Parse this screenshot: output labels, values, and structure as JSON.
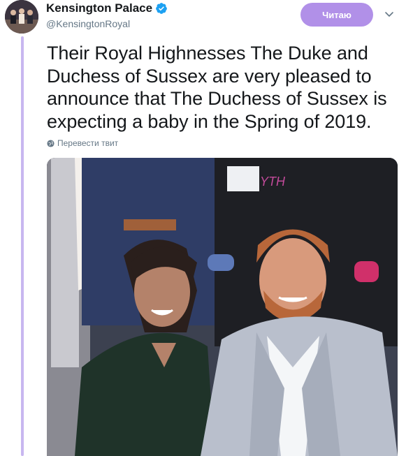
{
  "author": {
    "display_name": "Kensington Palace",
    "handle": "@KensingtonRoyal",
    "verified_icon": "verified-badge-icon"
  },
  "follow_button": {
    "label": "Читаю"
  },
  "menu_icon": "chevron-down-icon",
  "tweet": {
    "text": "Their Royal Highnesses The Duke and Duchess of Sussex are very pleased to announce that The Duchess of Sussex is expecting a baby in the Spring of 2019.",
    "translate_label": "Перевести твит"
  },
  "colors": {
    "follow_button_bg": "#b190e8",
    "thread_line": "#c8b7f0",
    "verified_blue": "#1da1f2"
  }
}
